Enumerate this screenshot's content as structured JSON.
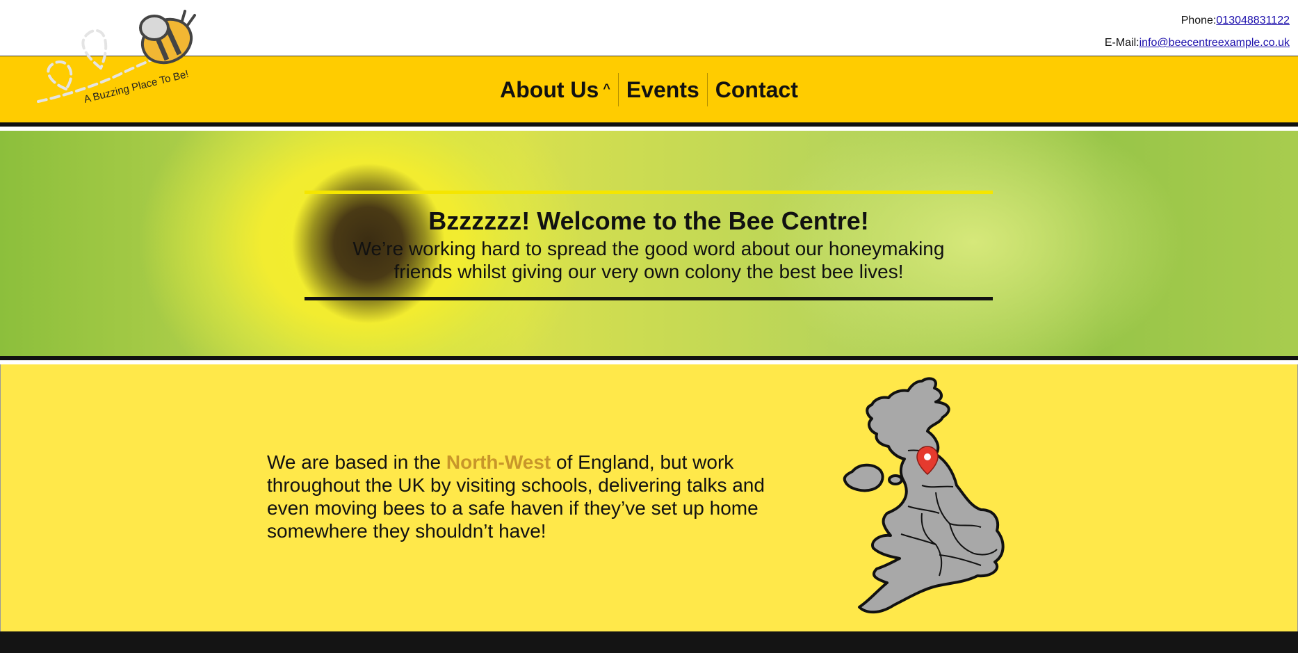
{
  "header": {
    "tagline": "A Buzzing Place To Be!",
    "phone_label": "Phone:",
    "phone_value": "013048831122",
    "email_label": "E-Mail:",
    "email_value": "info@beecentreexample.co.uk"
  },
  "nav": {
    "items": [
      {
        "label": "About Us"
      },
      {
        "label": "Events"
      },
      {
        "label": "Contact"
      }
    ]
  },
  "hero": {
    "title": "Bzzzzzz! Welcome to the Bee Centre!",
    "subtitle": "We’re working hard to spread the good word about our honeymaking friends whilst giving our very own colony the best bee lives!"
  },
  "info": {
    "text_before": "We are based in the ",
    "highlight": "North-West",
    "text_after": " of England, but work throughout the UK by visiting schools, delivering talks and even moving bees to a safe haven if they’ve set up home somewhere they shouldn’t have!"
  },
  "colors": {
    "nav_bg": "#ffcc00",
    "info_bg": "#ffe84a",
    "highlight": "#c8962a",
    "footer": "#141414"
  },
  "icons": {
    "logo": "bee-logo-icon",
    "caret": "chevron-up-icon",
    "map": "uk-map-icon",
    "pin": "map-pin-icon"
  }
}
